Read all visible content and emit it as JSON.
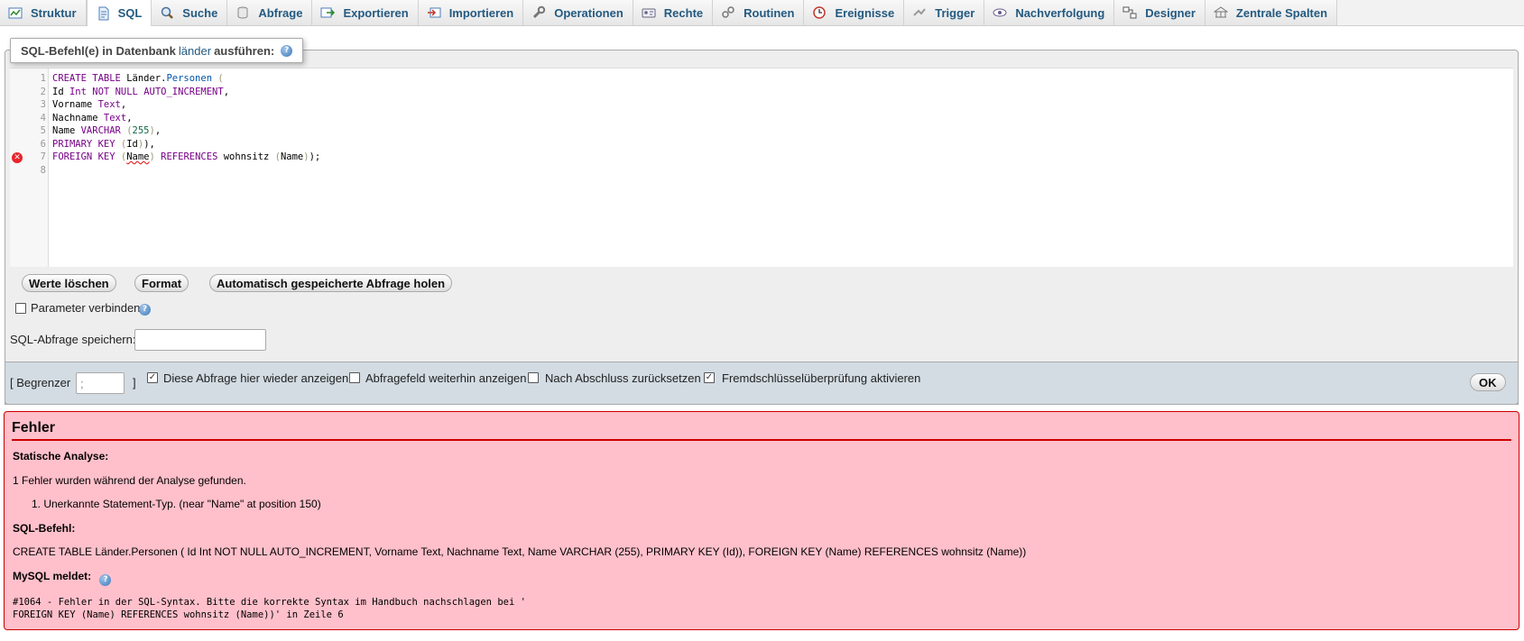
{
  "tabs": [
    {
      "label": "Struktur",
      "icon": "structure-icon"
    },
    {
      "label": "SQL",
      "icon": "sql-icon",
      "active": true
    },
    {
      "label": "Suche",
      "icon": "search-icon"
    },
    {
      "label": "Abfrage",
      "icon": "query-icon"
    },
    {
      "label": "Exportieren",
      "icon": "export-icon"
    },
    {
      "label": "Importieren",
      "icon": "import-icon"
    },
    {
      "label": "Operationen",
      "icon": "wrench-icon"
    },
    {
      "label": "Rechte",
      "icon": "privileges-icon"
    },
    {
      "label": "Routinen",
      "icon": "routines-icon"
    },
    {
      "label": "Ereignisse",
      "icon": "events-icon"
    },
    {
      "label": "Trigger",
      "icon": "trigger-icon"
    },
    {
      "label": "Nachverfolgung",
      "icon": "eye-icon"
    },
    {
      "label": "Designer",
      "icon": "designer-icon"
    },
    {
      "label": "Zentrale Spalten",
      "icon": "central-columns-icon"
    }
  ],
  "query_box": {
    "legend_prefix": "SQL-Befehl(e) in Datenbank",
    "database": "länder",
    "legend_suffix": "ausführen:",
    "line_numbers": [
      "1",
      "2",
      "3",
      "4",
      "5",
      "6",
      "7",
      "8"
    ],
    "error_line": "7",
    "buttons": {
      "clear": "Werte löschen",
      "format": "Format",
      "autosave": "Automatisch gespeicherte Abfrage holen"
    },
    "bind_parameters_label": "Parameter verbinden",
    "save_label": "SQL-Abfrage speichern:",
    "save_value": ""
  },
  "options": {
    "delimiter_open": "[ Begrenzer",
    "delimiter_value": ";",
    "delimiter_close": "]",
    "show_query_again": {
      "label": "Diese Abfrage hier wieder anzeigen",
      "checked": true
    },
    "retain_query_box": {
      "label": "Abfragefeld weiterhin anzeigen",
      "checked": false
    },
    "rollback_on_finish": {
      "label": "Nach Abschluss zurücksetzen",
      "checked": false
    },
    "foreign_key_checks": {
      "label": "Fremdschlüsselüberprüfung aktivieren",
      "checked": true
    },
    "ok_label": "OK"
  },
  "error": {
    "title": "Fehler",
    "static_analysis_label": "Statische Analyse:",
    "found_text": "1 Fehler wurden während der Analyse gefunden.",
    "items": [
      "1.  Unerkannte Statement-Typ. (near \"Name\" at position 150)"
    ],
    "sql_label": "SQL-Befehl:",
    "sql_text": "CREATE TABLE Länder.Personen ( Id Int NOT NULL AUTO_INCREMENT, Vorname Text, Nachname Text, Name VARCHAR (255), PRIMARY KEY (Id)), FOREIGN KEY (Name) REFERENCES wohnsitz (Name))",
    "mysql_label": "MySQL meldet:",
    "message_line1": "#1064 - Fehler in der SQL-Syntax. Bitte die korrekte Syntax im Handbuch nachschlagen bei '",
    "message_line2": "FOREIGN KEY (Name) REFERENCES wohnsitz (Name))' in Zeile 6"
  },
  "colors": {
    "tab_text": "#235a81",
    "keyword": "#770088",
    "builtin": "#0055aa",
    "number": "#116644",
    "error_bg": "#ffc0cb",
    "error_border": "#cc0000"
  }
}
